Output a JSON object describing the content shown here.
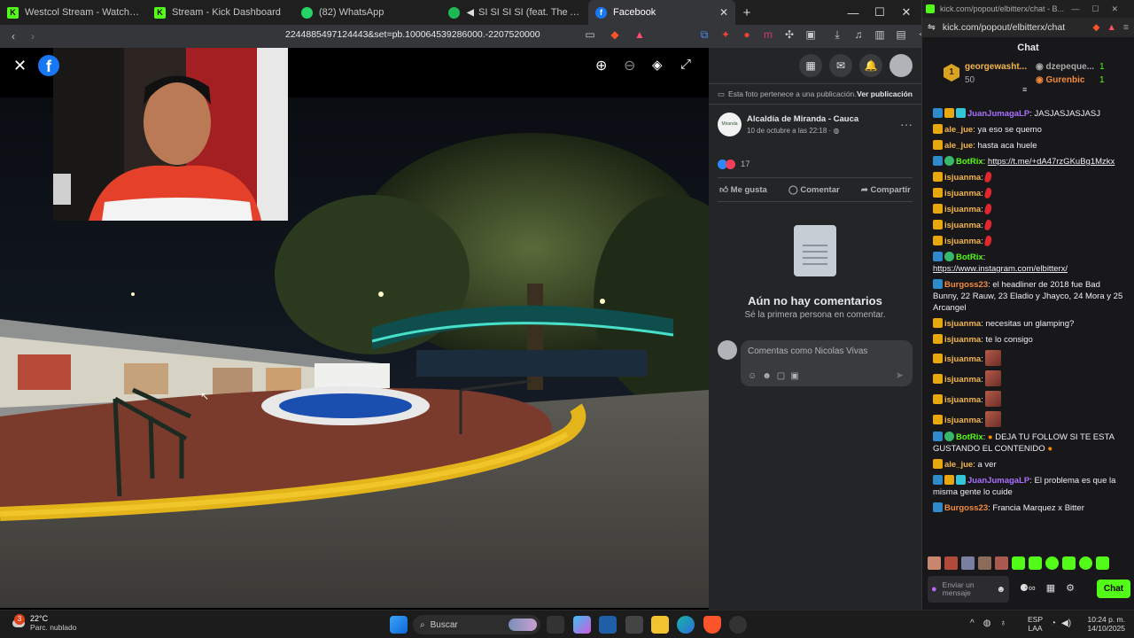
{
  "browser": {
    "tabs": [
      {
        "label": "Westcol Stream - Watch Live on Kick",
        "icon": "kick-icon",
        "color": "#53fc18"
      },
      {
        "label": "Stream - Kick Dashboard",
        "icon": "kick-icon",
        "color": "#53fc18"
      },
      {
        "label": "(82) WhatsApp",
        "icon": "whatsapp-icon",
        "color": "#25d366"
      },
      {
        "label": "SI SI SI SI (feat. The Academy: Se",
        "icon": "spotify-icon",
        "color": "#1db954"
      },
      {
        "label": "Facebook",
        "icon": "facebook-icon",
        "color": "#1877f2"
      }
    ],
    "url": "2244885497124443&set=pb.100064539286000.-2207520000"
  },
  "facebook": {
    "notice": "Esta foto pertenece a una publicación.",
    "notice_link": "Ver publicación",
    "page_name": "Alcaldía de Miranda - Cauca",
    "post_date": "10 de octubre a las 22:18 ·",
    "reactions_count": "17",
    "like_label": "Me gusta",
    "comment_label": "Comentar",
    "share_label": "Compartir",
    "no_comments_title": "Aún no hay comentarios",
    "no_comments_sub": "Sé la primera persona en comentar.",
    "comment_placeholder": "Comentas como Nicolas Vivas",
    "avatar_text": "Miranda"
  },
  "chat": {
    "window_url": "kick.com/popout/elbitterx/chat - B...",
    "address": "kick.com/popout/elbitterx/chat",
    "title": "Chat",
    "leaderboard": [
      {
        "rank": "1",
        "name": "georgewasht...",
        "value": "50"
      },
      {
        "name": "dzepeque...",
        "value": "1"
      },
      {
        "name": "Gurenbic",
        "value": "1"
      }
    ],
    "messages": [
      {
        "user": "JuanJumagaLP",
        "text": "JASJASJASJASJ"
      },
      {
        "user": "ale_jue",
        "text": "ya eso se quemo"
      },
      {
        "user": "ale_jue",
        "text": "hasta aca huele"
      },
      {
        "user": "BotRix",
        "text": "https://t.me/+dA47rzGKuBg1Mzkx"
      },
      {
        "user": "isjuanma",
        "text": ""
      },
      {
        "user": "isjuanma",
        "text": ""
      },
      {
        "user": "isjuanma",
        "text": ""
      },
      {
        "user": "isjuanma",
        "text": ""
      },
      {
        "user": "isjuanma",
        "text": ""
      },
      {
        "user": "BotRix",
        "text": "https://www.instagram.com/elbitterx/"
      },
      {
        "user": "Burgoss23",
        "text": "el headliner de 2018 fue Bad Bunny, 22 Rauw, 23 Eladio y Jhayco, 24 Mora y 25 Arcangel"
      },
      {
        "user": "isjuanma",
        "text": "necesitas un glamping?"
      },
      {
        "user": "isjuanma",
        "text": "te lo consigo"
      },
      {
        "user": "isjuanma",
        "text": ""
      },
      {
        "user": "isjuanma",
        "text": ""
      },
      {
        "user": "isjuanma",
        "text": ""
      },
      {
        "user": "isjuanma",
        "text": ""
      },
      {
        "user": "BotRix",
        "text": "DEJA TU FOLLOW SI TE ESTA GUSTANDO EL CONTENIDO"
      },
      {
        "user": "ale_jue",
        "text": "a ver"
      },
      {
        "user": "JuanJumagaLP",
        "text": "El problema es que la misma gente lo cuide"
      },
      {
        "user": "Burgoss23",
        "text": "Francia Marquez x Bitter"
      }
    ],
    "input_placeholder": "Enviar un mensaje",
    "send_label": "Chat"
  },
  "taskbar": {
    "weather_temp": "22°C",
    "weather_desc": "Parc. nublado",
    "weather_badge": "3",
    "search_label": "Buscar",
    "lang": "ESP",
    "lang_sub": "LAA",
    "time": "10:24 p. m.",
    "date": "14/10/2025"
  },
  "colors": {
    "kick_green": "#53fc18",
    "fb_blue": "#2d88ff",
    "taskbar_bg": "#1c1c1c"
  }
}
